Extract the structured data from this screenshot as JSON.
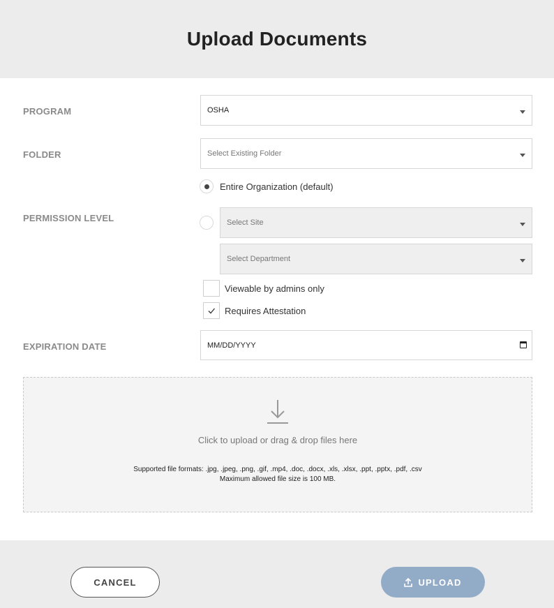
{
  "header": {
    "title": "Upload Documents"
  },
  "program": {
    "label": "PROGRAM",
    "value": "OSHA"
  },
  "folder": {
    "label": "FOLDER",
    "placeholder": "Select Existing Folder"
  },
  "permission": {
    "label": "PERMISSION LEVEL",
    "option_org": "Entire Organization (default)",
    "site_placeholder": "Select Site",
    "department_placeholder": "Select Department",
    "selected": "org"
  },
  "checkboxes": {
    "admins_only": {
      "label": "Viewable by admins only",
      "checked": false
    },
    "attestation": {
      "label": "Requires Attestation",
      "checked": true
    }
  },
  "expiration": {
    "label": "EXPIRATION DATE",
    "placeholder": "MM/DD/YYYY"
  },
  "dropzone": {
    "instruction": "Click to upload or drag & drop files here",
    "formats": "Supported file formats: .jpg, .jpeg, .png, .gif, .mp4, .doc, .docx, .xls, .xlsx, .ppt, .pptx, .pdf, .csv",
    "max_size": "Maximum allowed file size is 100 MB."
  },
  "footer": {
    "cancel_label": "CANCEL",
    "upload_label": "UPLOAD"
  },
  "icons": {
    "download": "download-icon",
    "upload": "upload-icon",
    "calendar": "calendar-icon",
    "caret": "chevron-down-icon",
    "check": "checkmark-icon"
  },
  "colors": {
    "upload_button": "#92acc8",
    "header_bg": "#ececec",
    "dropzone_bg": "#f4f4f4"
  }
}
